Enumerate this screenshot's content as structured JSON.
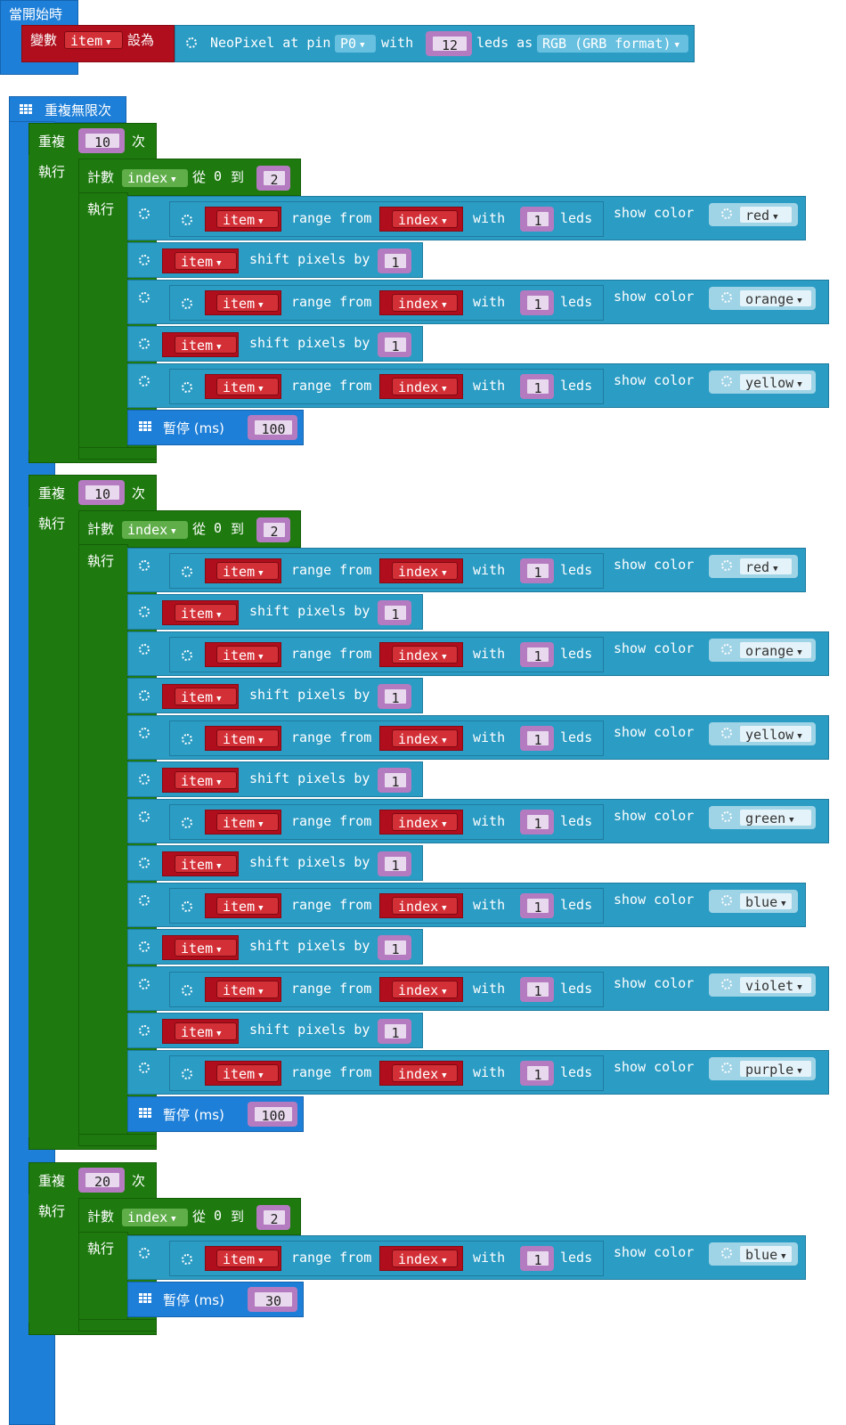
{
  "start": {
    "hat_label": "當開始時",
    "set_label": "變數",
    "var": "item",
    "to_label": "設為",
    "neopixel_label": "NeoPixel at pin",
    "pin": "P0",
    "with_label": "with",
    "led_count": "12",
    "leds_as_label": "leds as",
    "format": "RGB (GRB format)"
  },
  "forever": {
    "label": "重複無限次"
  },
  "labels": {
    "repeat": "重複",
    "times": "次",
    "do": "執行",
    "count": "計數",
    "from": "從",
    "zero": "0",
    "to": "到",
    "range_from": "range from",
    "with": "with",
    "leds": "leds",
    "show_color": "show color",
    "shift": "shift pixels by",
    "pause": "暫停 (ms)",
    "item": "item",
    "index": "index",
    "one": "1"
  },
  "loops": [
    {
      "repeat": "10",
      "count_to": "2",
      "colors": [
        "red",
        "orange",
        "yellow"
      ],
      "pause": "100"
    },
    {
      "repeat": "10",
      "count_to": "2",
      "colors": [
        "red",
        "orange",
        "yellow",
        "green",
        "blue",
        "violet",
        "purple"
      ],
      "pause": "100"
    },
    {
      "repeat": "20",
      "count_to": "2",
      "colors": [
        "blue"
      ],
      "pause": "30"
    }
  ],
  "colors": {
    "logic_blue": "#1e7fd8",
    "loop_green": "#1e7a0f",
    "variable_red": "#b00e1c",
    "neopixel_teal": "#2b9cc4"
  }
}
